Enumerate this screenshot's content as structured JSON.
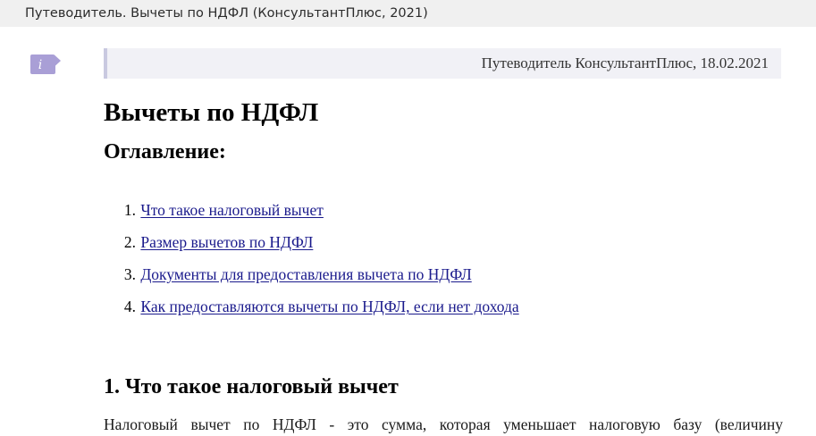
{
  "window": {
    "title": "Путеводитель. Вычеты по НДФЛ (КонсультантПлюс, 2021)"
  },
  "header": {
    "info_icon": "info-icon",
    "info_glyph": "i",
    "source_note": "Путеводитель КонсультантПлюс, 18.02.2021"
  },
  "document": {
    "title": "Вычеты по НДФЛ",
    "toc_heading": "Оглавление:",
    "toc": [
      {
        "num": "1.",
        "label": "Что такое налоговый вычет"
      },
      {
        "num": "2.",
        "label": "Размер вычетов по НДФЛ"
      },
      {
        "num": "3.",
        "label": "Документы для предоставления вычета по НДФЛ"
      },
      {
        "num": "4.",
        "label": "Как предоставляются вычеты по НДФЛ, если нет дохода"
      }
    ],
    "section_1_title": "1. Что такое налоговый вычет",
    "section_1_text": "Налоговый вычет по НДФЛ - это сумма, которая уменьшает налоговую базу (величину"
  },
  "colors": {
    "link": "#1a1a8c",
    "info_badge": "#a99fd6",
    "header_bar_bg": "#f1f1f6",
    "header_bar_accent": "#c9c9e0"
  }
}
